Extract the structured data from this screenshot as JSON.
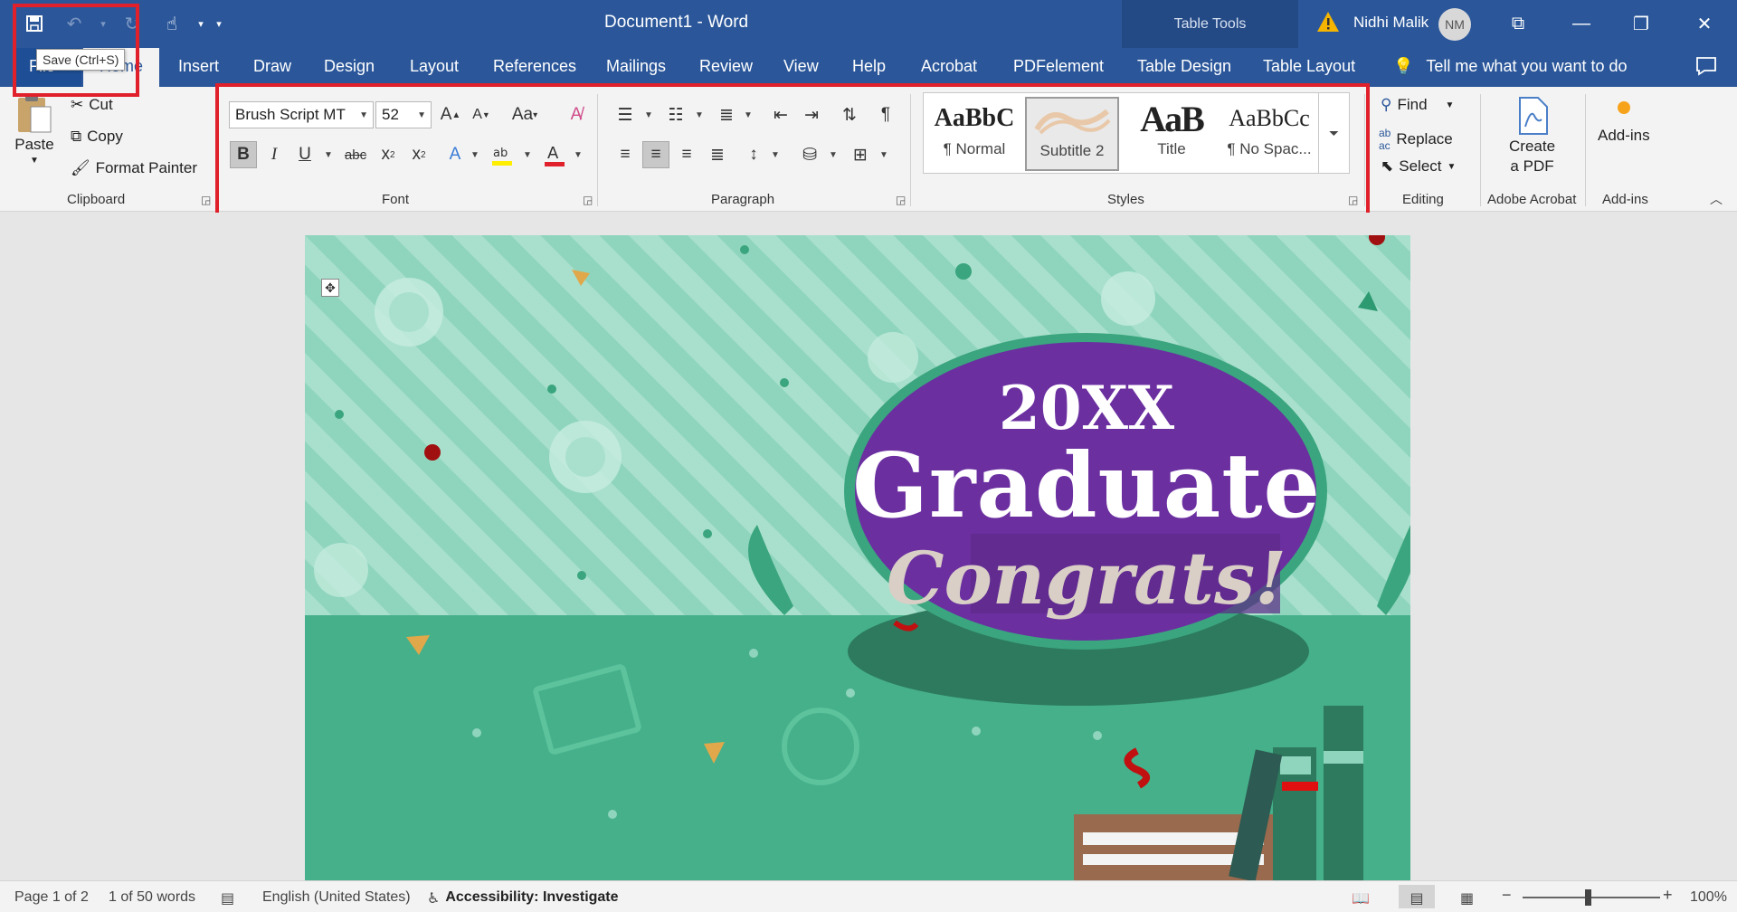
{
  "titlebar": {
    "document": "Document1",
    "separator": "-",
    "app": "Word",
    "context_tools": "Table Tools",
    "user": "Nidhi Malik",
    "user_initials": "NM"
  },
  "tooltip": "Save (Ctrl+S)",
  "tabs": [
    {
      "label": "File"
    },
    {
      "label": "Home"
    },
    {
      "label": "Insert"
    },
    {
      "label": "Draw"
    },
    {
      "label": "Design"
    },
    {
      "label": "Layout"
    },
    {
      "label": "References"
    },
    {
      "label": "Mailings"
    },
    {
      "label": "Review"
    },
    {
      "label": "View"
    },
    {
      "label": "Help"
    },
    {
      "label": "Acrobat"
    },
    {
      "label": "PDFelement"
    },
    {
      "label": "Table Design"
    },
    {
      "label": "Table Layout"
    }
  ],
  "tell_me": "Tell me what you want to do",
  "clipboard": {
    "paste": "Paste",
    "cut": "Cut",
    "copy": "Copy",
    "format_painter": "Format Painter",
    "label": "Clipboard"
  },
  "font": {
    "family": "Brush Script MT",
    "size": "52",
    "change_case": "Aa",
    "label": "Font"
  },
  "paragraph": {
    "label": "Paragraph"
  },
  "styles": {
    "label": "Styles",
    "items": [
      {
        "preview": "AaBbC",
        "name": "¶ Normal"
      },
      {
        "preview": "",
        "name": "Subtitle 2"
      },
      {
        "preview": "AaB",
        "name": "Title"
      },
      {
        "preview": "AaBbCc",
        "name": "¶ No Spac..."
      }
    ]
  },
  "editing": {
    "find": "Find",
    "replace": "Replace",
    "select": "Select",
    "label": "Editing"
  },
  "acrobat": {
    "create_line1": "Create",
    "create_line2": "a PDF",
    "label": "Adobe Acrobat"
  },
  "addins": {
    "button": "Add-ins",
    "label": "Add-ins"
  },
  "document": {
    "year": "20XX",
    "headline": "Graduate",
    "tagline": "Congrats!"
  },
  "status": {
    "page": "Page 1 of 2",
    "words": "1 of 50 words",
    "language": "English (United States)",
    "accessibility": "Accessibility: Investigate",
    "zoom": "100%"
  },
  "colors": {
    "ribbon_blue": "#2b579a",
    "banner_stripes": "#8fd5bd",
    "banner_green": "#45b08a",
    "oval_purple": "#6b2fa0",
    "oval_border": "#3aa57e",
    "highlight_red": "#e0202a"
  }
}
